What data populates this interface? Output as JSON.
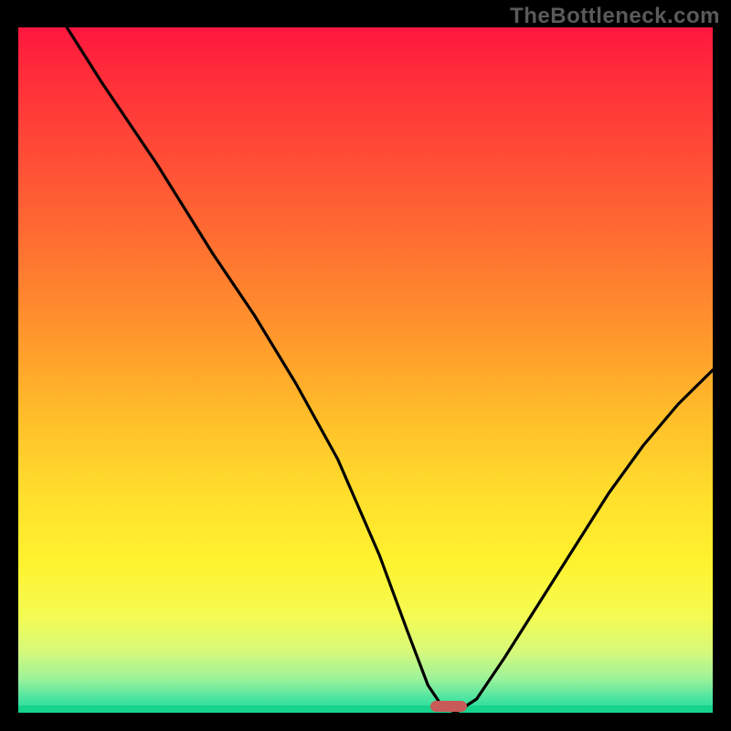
{
  "watermark": "TheBottleneck.com",
  "chart_data": {
    "type": "line",
    "title": "",
    "xlabel": "",
    "ylabel": "",
    "xlim": [
      0,
      100
    ],
    "ylim": [
      0,
      100
    ],
    "grid": false,
    "legend": false,
    "background": "rainbow-gradient red(top)→green(bottom)",
    "note": "Values read off the plot; y is % of plot height from the bottom (0=bottom green band, 100=top red).",
    "series": [
      {
        "name": "bottleneck-curve",
        "x": [
          7,
          12,
          20,
          28,
          34,
          40,
          46,
          52,
          56,
          59,
          61,
          63,
          66,
          70,
          75,
          80,
          85,
          90,
          95,
          100
        ],
        "y": [
          100,
          92,
          80,
          67,
          58,
          48,
          37,
          23,
          12,
          4,
          1,
          0,
          2,
          8,
          16,
          24,
          32,
          39,
          45,
          50
        ]
      }
    ],
    "marker": {
      "name": "optimal-point",
      "x": 62,
      "y": 0,
      "color": "#c85a58",
      "shape": "rounded-bar"
    }
  }
}
